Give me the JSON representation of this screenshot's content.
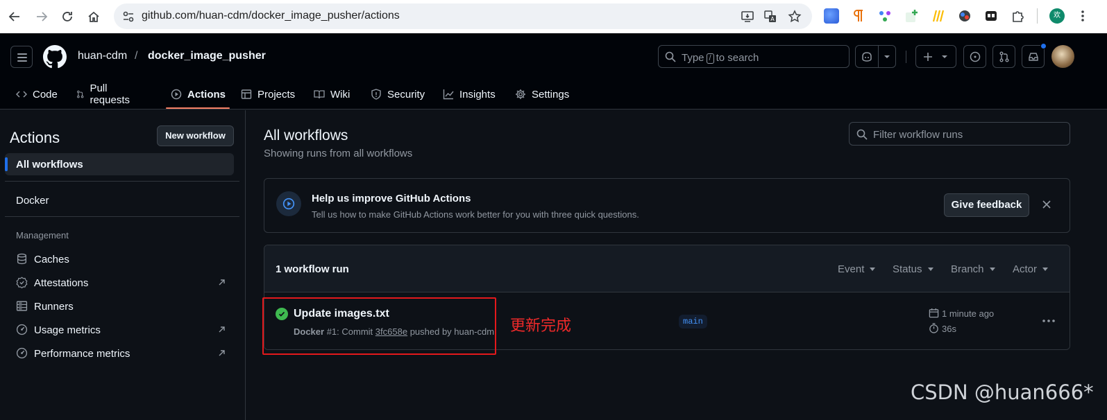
{
  "browser": {
    "url": "github.com/huan-cdm/docker_image_pusher/actions",
    "profile_initial": "欢"
  },
  "header": {
    "owner": "huan-cdm",
    "separator": "/",
    "repo": "docker_image_pusher",
    "search_prefix": "Type",
    "search_key": "/",
    "search_suffix": "to search"
  },
  "tabs": [
    {
      "label": "Code",
      "icon": "code-icon"
    },
    {
      "label": "Pull requests",
      "icon": "git-pull-request-icon"
    },
    {
      "label": "Actions",
      "icon": "play-icon",
      "active": true
    },
    {
      "label": "Projects",
      "icon": "table-icon"
    },
    {
      "label": "Wiki",
      "icon": "book-icon"
    },
    {
      "label": "Security",
      "icon": "shield-icon"
    },
    {
      "label": "Insights",
      "icon": "graph-icon"
    },
    {
      "label": "Settings",
      "icon": "gear-icon"
    }
  ],
  "sidebar": {
    "title": "Actions",
    "new_workflow": "New workflow",
    "all_workflows": "All workflows",
    "workflows": [
      "Docker"
    ],
    "management_heading": "Management",
    "management": [
      {
        "label": "Caches",
        "icon": "database-icon",
        "external": false
      },
      {
        "label": "Attestations",
        "icon": "verified-icon",
        "external": true
      },
      {
        "label": "Runners",
        "icon": "server-icon",
        "external": false
      },
      {
        "label": "Usage metrics",
        "icon": "meter-icon",
        "external": true
      },
      {
        "label": "Performance metrics",
        "icon": "meter-icon",
        "external": true
      }
    ]
  },
  "main": {
    "title": "All workflows",
    "subtitle": "Showing runs from all workflows",
    "filter_placeholder": "Filter workflow runs",
    "banner": {
      "title": "Help us improve GitHub Actions",
      "text": "Tell us how to make GitHub Actions work better for you with three quick questions.",
      "button": "Give feedback"
    },
    "runs": {
      "count": "1 workflow run",
      "filters": [
        "Event",
        "Status",
        "Branch",
        "Actor"
      ],
      "items": [
        {
          "title": "Update images.txt",
          "workflow": "Docker",
          "run_number": "#1: Commit",
          "commit": "3fc658e",
          "pushed_by": "pushed by huan-cdm",
          "branch": "main",
          "time": "1 minute ago",
          "duration": "36s",
          "status_color": "#3fb950"
        }
      ]
    }
  },
  "annotation": {
    "text": "更新完成",
    "color": "#e4191c"
  },
  "watermark": "CSDN @huan666*",
  "colors": {
    "accent": "#1f6feb",
    "tab_underline": "#f78166",
    "success": "#3fb950"
  }
}
